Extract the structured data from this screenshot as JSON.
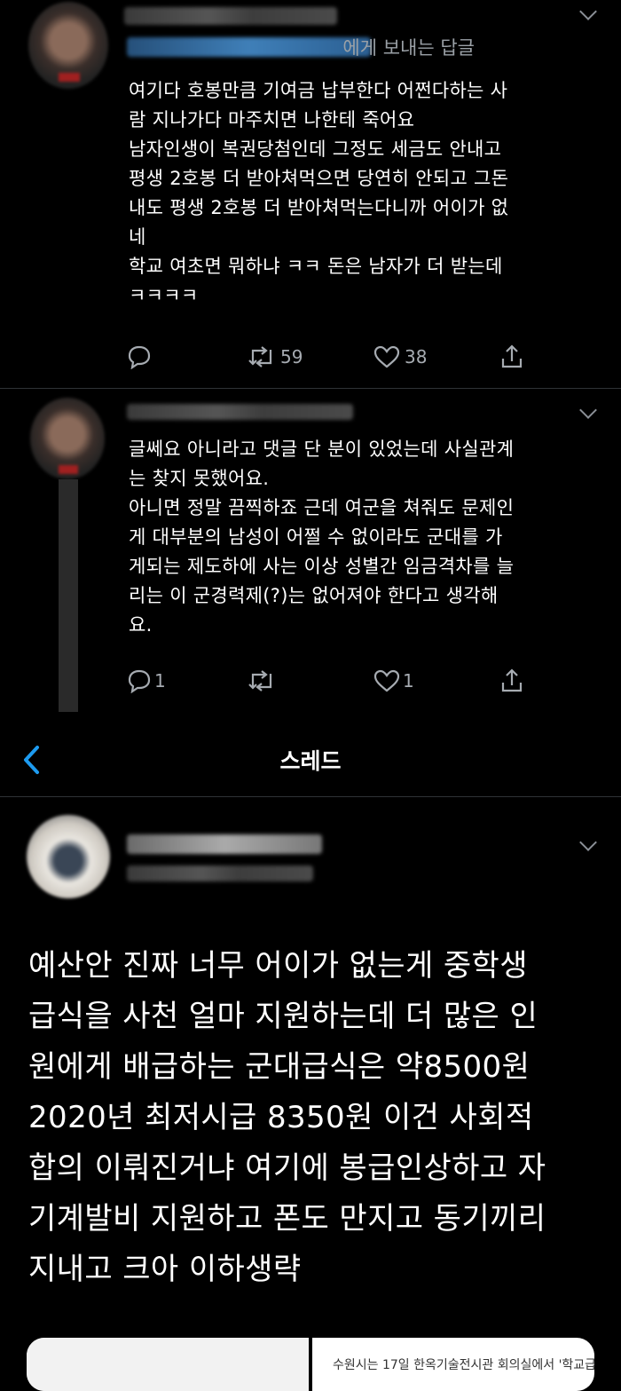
{
  "reply1": {
    "context_label": "에게 보내는 답글",
    "body": "여기다 호봉만큼 기여금 납부한다 어쩐다하는 사\n람 지나가다 마주치면 나한테 죽어요\n남자인생이 복권당첨인데 그정도 세금도 안내고\n평생 2호봉 더 받아쳐먹으면 당연히 안되고 그돈\n내도 평생 2호봉 더 받아쳐먹는다니까 어이가 없\n네\n학교 여초면 뭐하냐 ㅋㅋ 돈은 남자가 더 받는데\nㅋㅋㅋㅋ",
    "retweets": "59",
    "likes": "38"
  },
  "reply2": {
    "body": "글쎄요 아니라고 댓글 단 분이 있었는데 사실관계\n는 찾지 못했어요.\n아니면 정말 끔찍하죠 근데 여군을 쳐줘도 문제인\n게 대부분의 남성이 어쩔 수 없이라도 군대를 가\n게되는 제도하에 사는 이상 성별간 임금격차를 늘\n리는 이 군경력제(?)는 없어져야 한다고 생각해\n요.",
    "replies": "1",
    "likes": "1"
  },
  "thread_header": {
    "title": "스레드",
    "back_icon": "chevron-left-icon",
    "accent_color": "#1d9bf0"
  },
  "main_tweet": {
    "body": "예산안 진짜 너무 어이가 없는게 중학생\n급식을 사천 얼마 지원하는데 더 많은 인\n원에게 배급하는 군대급식은 약8500원\n2020년 최저시급 8350원 이건 사회적\n합의 이뤄진거냐 여기에 봉급인상하고 자\n기계발비 지원하고 폰도 만지고 동기끼리\n지내고 크아 이하생략",
    "card_caption": "수원시는 17일 한옥기술전시관 회의실에서 '학교급"
  }
}
